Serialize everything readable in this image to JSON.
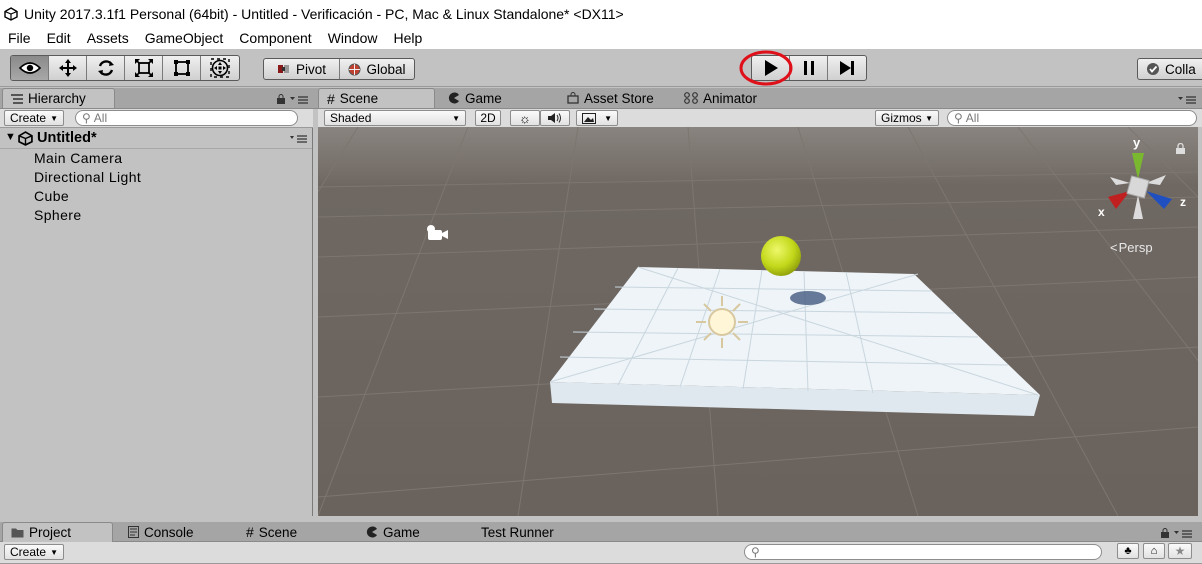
{
  "window": {
    "title": "Unity 2017.3.1f1 Personal (64bit) - Untitled - Verificación - PC, Mac & Linux Standalone* <DX11>"
  },
  "menu": [
    "File",
    "Edit",
    "Assets",
    "GameObject",
    "Component",
    "Window",
    "Help"
  ],
  "toolbar": {
    "tools": [
      "eye-icon",
      "move-icon",
      "rotate-icon",
      "scale-icon",
      "rect-icon",
      "transform-icon"
    ],
    "pivot_label": "Pivot",
    "global_label": "Global",
    "collab_label": "Colla"
  },
  "hierarchy": {
    "tab_label": "Hierarchy",
    "create_label": "Create",
    "search_placeholder": "All",
    "scene_name": "Untitled*",
    "items": [
      "Main Camera",
      "Directional Light",
      "Cube",
      "Sphere"
    ]
  },
  "scene_tabs": [
    "Scene",
    "Game",
    "Asset Store",
    "Animator"
  ],
  "scene_toolbar": {
    "shading": "Shaded",
    "mode_2d": "2D",
    "gizmos": "Gizmos",
    "search_placeholder": "All"
  },
  "scene_gizmo": {
    "y": "y",
    "x": "x",
    "z": "z",
    "persp": "Persp"
  },
  "bottom_tabs": [
    "Project",
    "Console",
    "Scene",
    "Game",
    "Test Runner"
  ],
  "project": {
    "create_label": "Create"
  },
  "colors": {
    "highlight_circle": "#e0101a",
    "scene_bg": "#6b635e",
    "sphere": "#c8e020",
    "plane": "#eef4f8"
  }
}
